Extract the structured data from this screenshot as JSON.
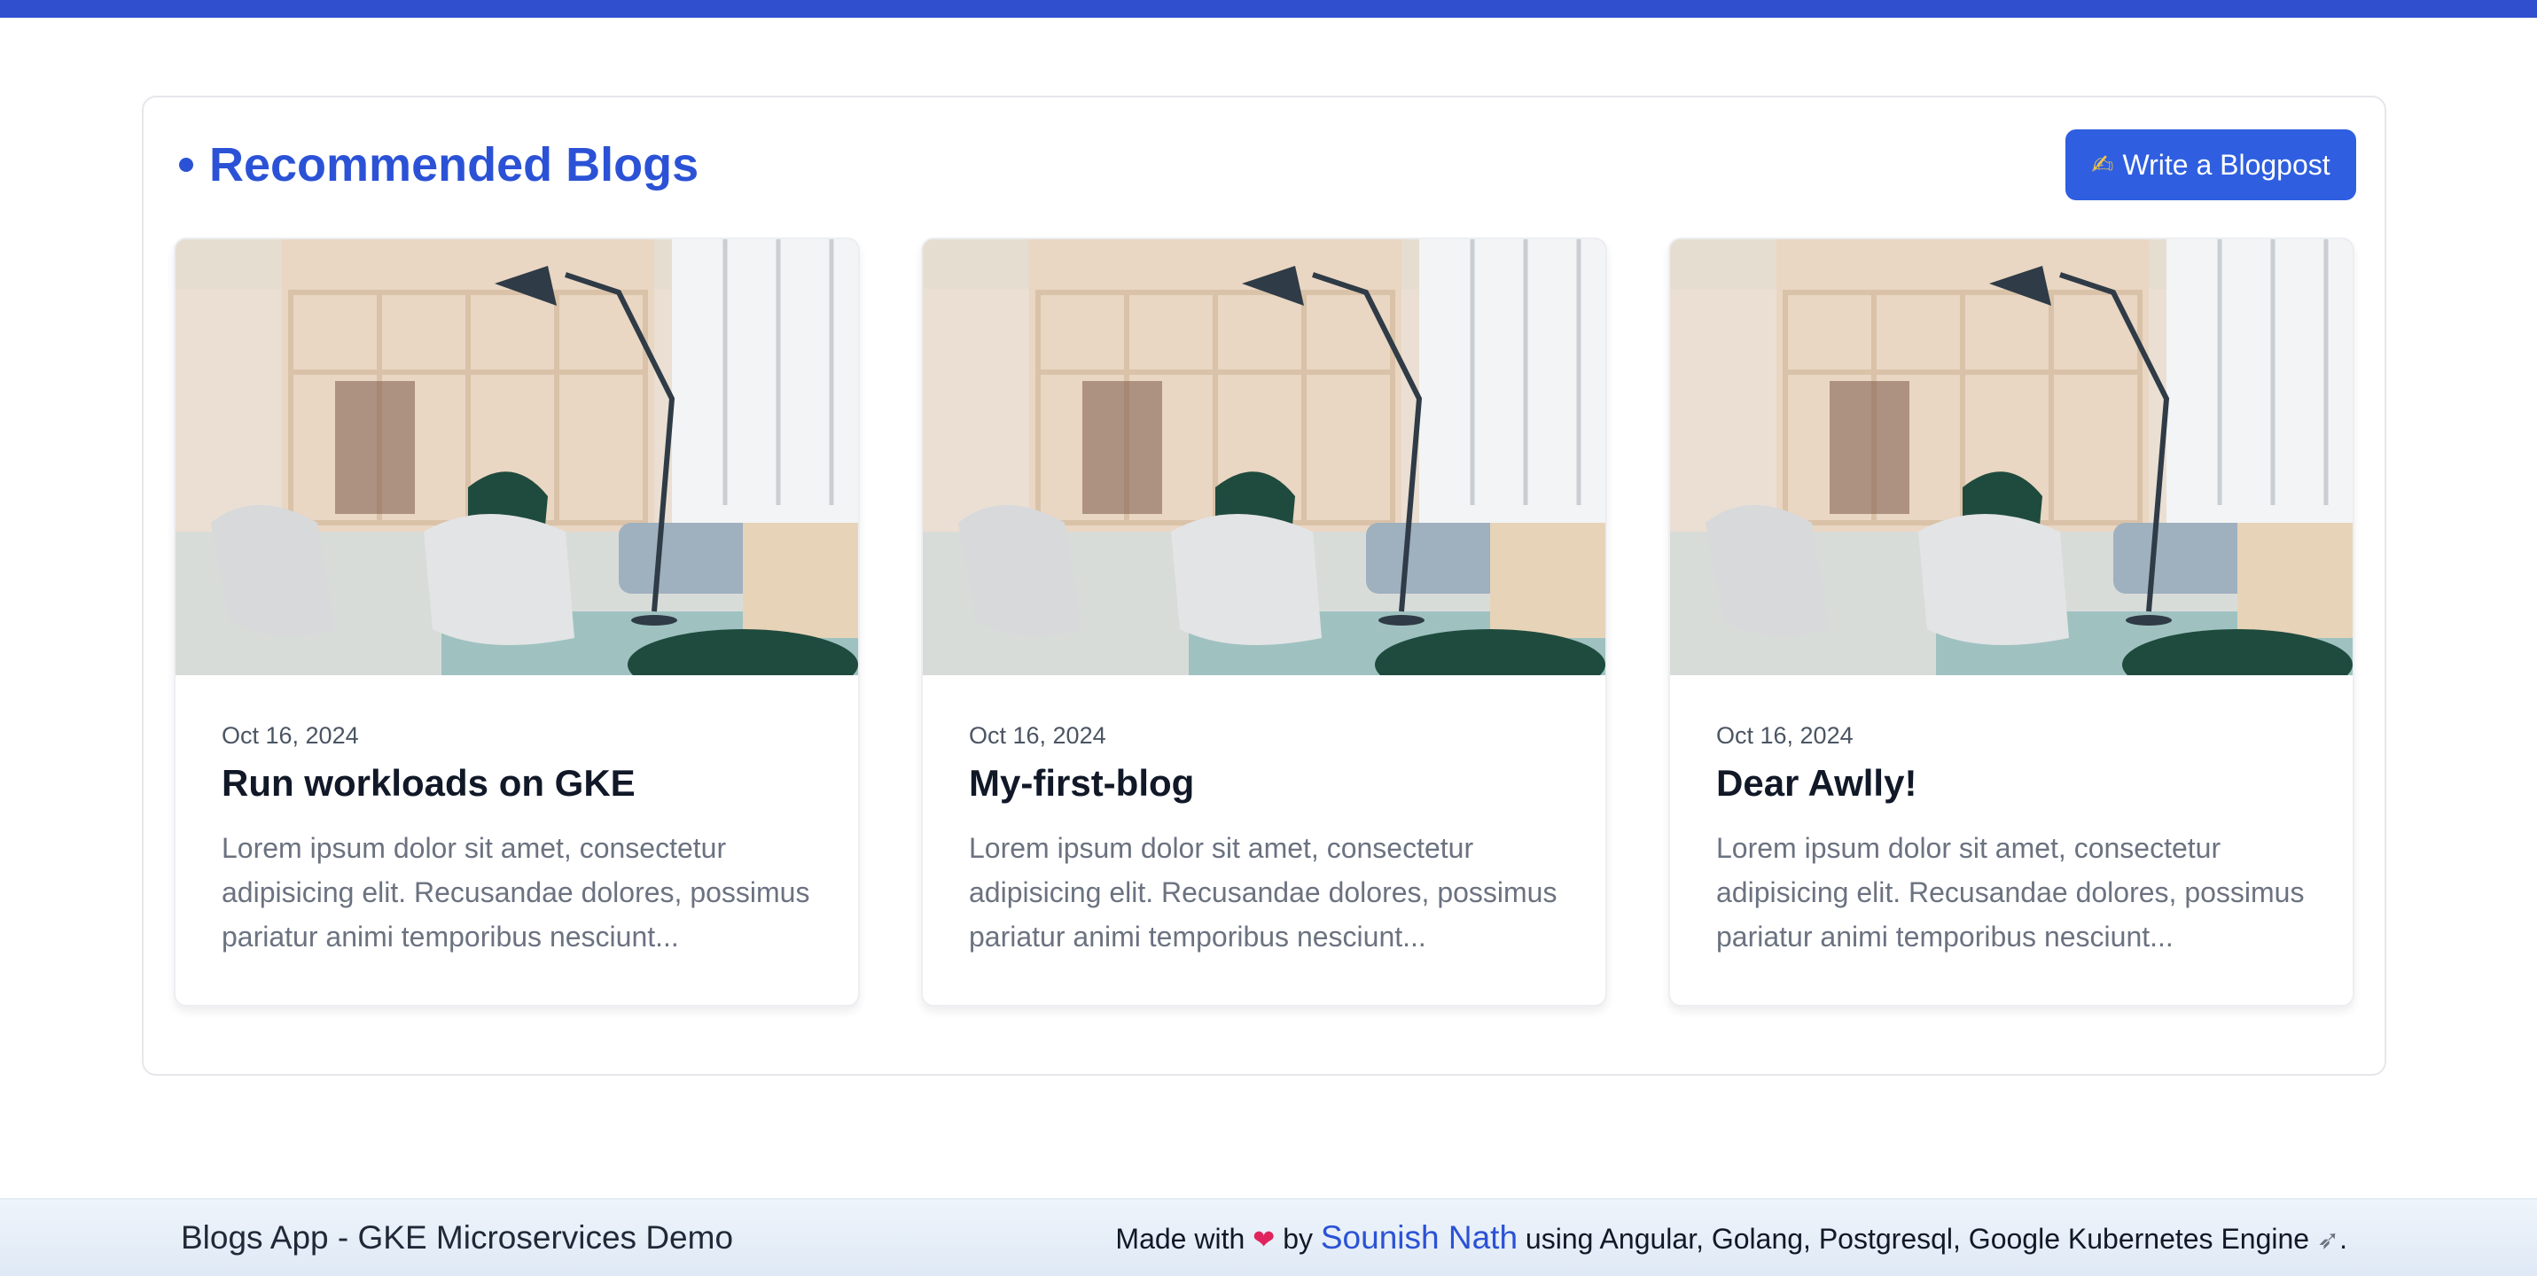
{
  "header": {
    "title": "Recommended Blogs",
    "write_button_label": "Write a Blogpost",
    "write_button_icon": "writing-hand-icon",
    "accent_color": "#2b52d6"
  },
  "blogs": [
    {
      "date": "Oct 16, 2024",
      "title": "Run workloads on GKE",
      "excerpt": "Lorem ipsum dolor sit amet, consectetur adipisicing elit. Recusandae dolores, possimus pariatur animi temporibus nesciunt...",
      "image": "modern-lounge-interior-photo"
    },
    {
      "date": "Oct 16, 2024",
      "title": "My-first-blog",
      "excerpt": "Lorem ipsum dolor sit amet, consectetur adipisicing elit. Recusandae dolores, possimus pariatur animi temporibus nesciunt...",
      "image": "modern-lounge-interior-photo"
    },
    {
      "date": "Oct 16, 2024",
      "title": "Dear Awlly!",
      "excerpt": "Lorem ipsum dolor sit amet, consectetur adipisicing elit. Recusandae dolores, possimus pariatur animi temporibus nesciunt...",
      "image": "modern-lounge-interior-photo"
    }
  ],
  "footer": {
    "app_name": "Blogs App - GKE Microservices Demo",
    "made_with": "Made with",
    "by": "by",
    "author": "Sounish Nath",
    "tech_stack": "using Angular, Golang, Postgresql, Google Kubernetes Engine",
    "heart_icon": "heart-icon",
    "rocket_icon": "rocket-icon"
  }
}
